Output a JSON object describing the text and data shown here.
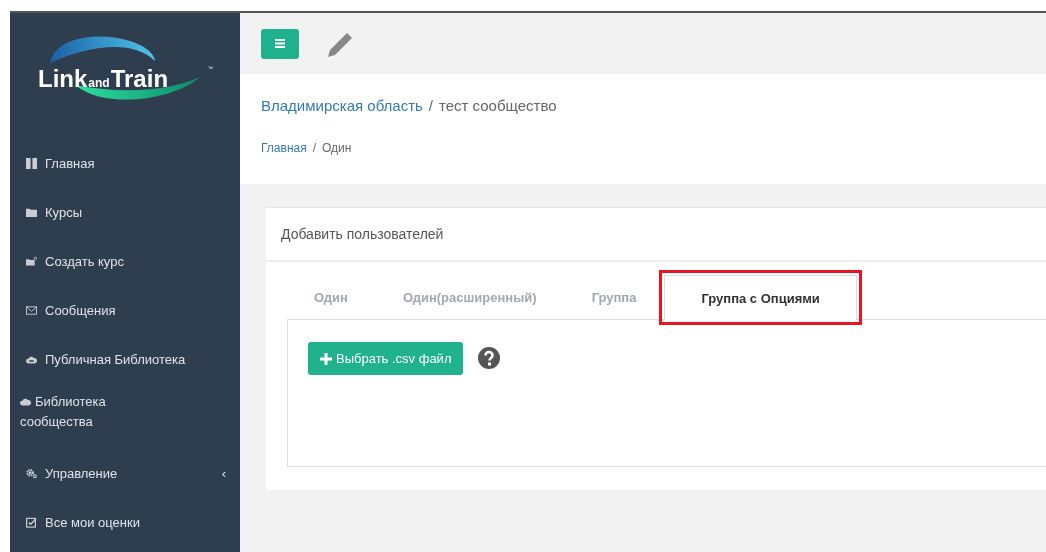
{
  "logo": {
    "parts": [
      "Link",
      "and",
      "Train"
    ],
    "trademark": "™"
  },
  "sidebar": {
    "items": [
      {
        "label": "Главная"
      },
      {
        "label": "Курсы"
      },
      {
        "label": "Создать курс"
      },
      {
        "label": "Сообщения"
      },
      {
        "label": "Публичная Библиотека"
      },
      {
        "label": "Библиотека сообщества"
      },
      {
        "label": "Управление",
        "caret": "‹"
      },
      {
        "label": "Все мои оценки"
      }
    ]
  },
  "breadcrumb_top": [
    {
      "kind": "link",
      "label": "Владимирская область"
    },
    {
      "kind": "separator",
      "label": "/"
    },
    {
      "kind": "current",
      "label": "тест сообщество"
    }
  ],
  "breadcrumb": [
    {
      "kind": "link",
      "label": "Главная"
    },
    {
      "kind": "separator",
      "label": "/"
    },
    {
      "kind": "current",
      "label": "Один"
    }
  ],
  "card": {
    "title": "Добавить пользователей",
    "tabs": [
      {
        "label": "Один",
        "selected": false,
        "highlighted": false
      },
      {
        "label": "Один(расширенный)",
        "selected": false,
        "highlighted": false
      },
      {
        "label": "Группа",
        "selected": false,
        "highlighted": false
      },
      {
        "label": "Группа с Опциями",
        "selected": true,
        "highlighted": true
      }
    ],
    "upload_button": "Выбрать .csv файл"
  }
}
